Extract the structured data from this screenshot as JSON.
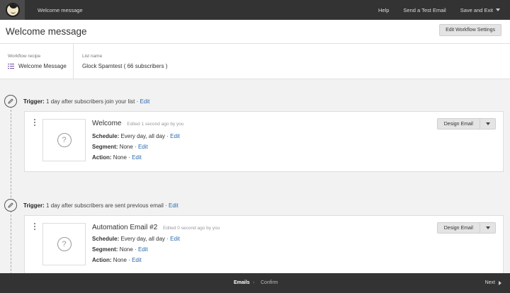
{
  "topbar": {
    "title": "Welcome message",
    "help": "Help",
    "send_test": "Send a Test Email",
    "save_exit": "Save and Exit"
  },
  "header": {
    "title": "Welcome message",
    "edit_settings": "Edit Workflow Settings"
  },
  "info": {
    "recipe_label": "Workflow recipe",
    "recipe_value": "Welcome Message",
    "list_label": "List name",
    "list_value": "Glock Spamtest ( 66 subscribers )"
  },
  "emails": [
    {
      "trigger_label": "Trigger:",
      "trigger_text": "1 day after subscribers join your list",
      "trigger_edit": "Edit",
      "name": "Welcome",
      "edited": "Edited 1 second ago by you",
      "schedule_label": "Schedule:",
      "schedule_value": "Every day, all day",
      "segment_label": "Segment:",
      "segment_value": "None",
      "action_label": "Action:",
      "action_value": "None",
      "edit": "Edit",
      "design_button": "Design Email"
    },
    {
      "trigger_label": "Trigger:",
      "trigger_text": "1 day after subscribers are sent previous email",
      "trigger_edit": "Edit",
      "name": "Automation Email #2",
      "edited": "Edited 0 second ago by you",
      "schedule_label": "Schedule:",
      "schedule_value": "Every day, all day",
      "segment_label": "Segment:",
      "segment_value": "None",
      "action_label": "Action:",
      "action_value": "None",
      "edit": "Edit",
      "design_button": "Design Email"
    }
  ],
  "footer": {
    "step_emails": "Emails",
    "step_sep": "›",
    "step_confirm": "Confirm",
    "next": "Next"
  },
  "icons": {
    "placeholder": "?",
    "sep": "·"
  },
  "colors": {
    "topbar": "#333333",
    "link": "#2a6cb0",
    "recipe_icon": "#6b4aa0"
  }
}
